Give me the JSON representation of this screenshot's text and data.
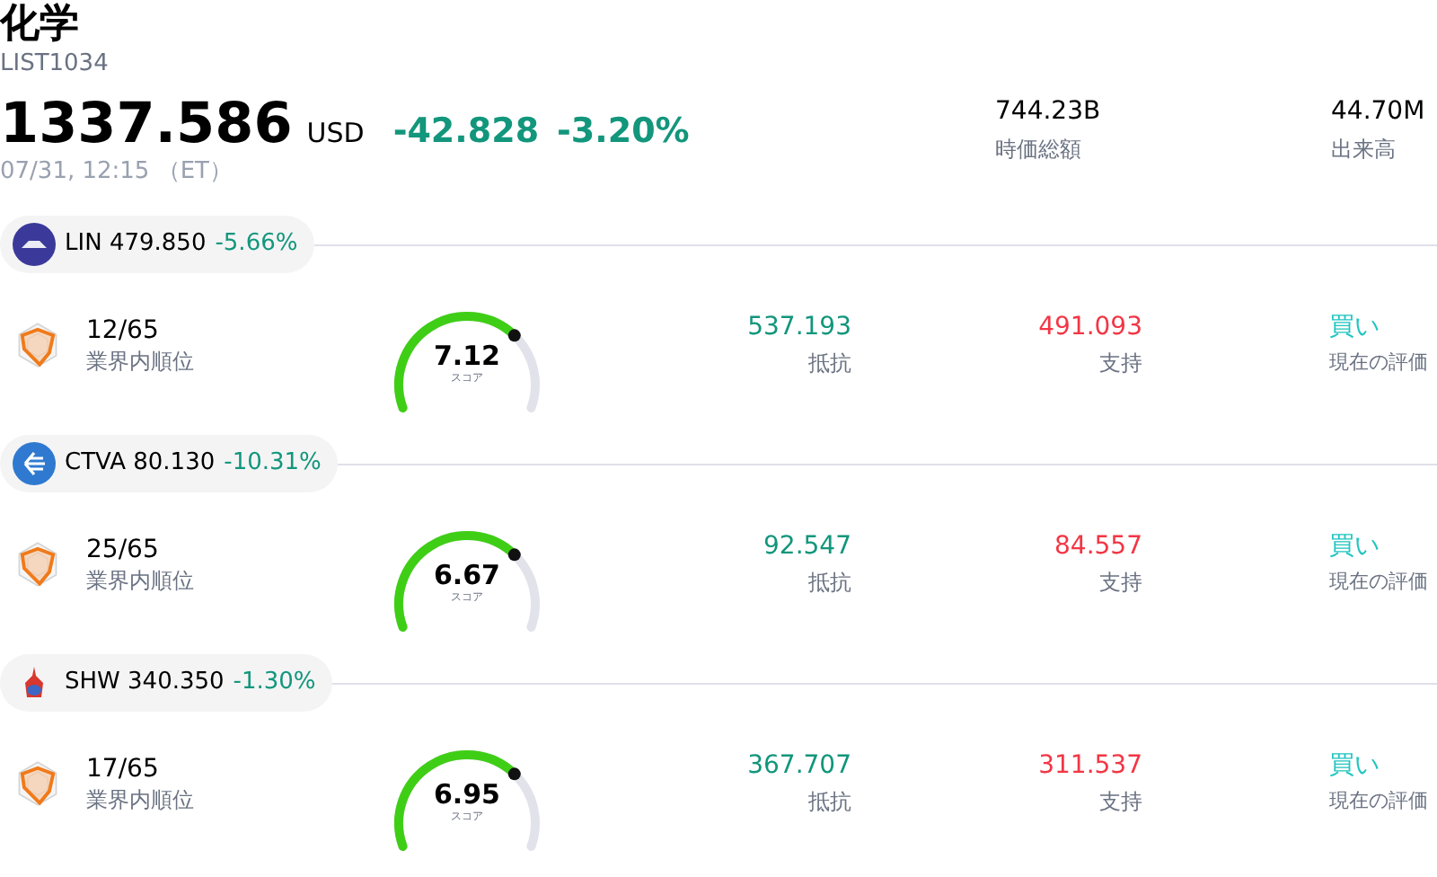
{
  "header": {
    "title": "化学",
    "code": "LIST1034",
    "price": "1337.586",
    "currency": "USD",
    "change": "-42.828",
    "change_percent": "-3.20%",
    "timestamp": "07/31, 12:15 （ET）",
    "stats": [
      {
        "value": "744.23B",
        "label": "時価総額"
      },
      {
        "value": "44.70M",
        "label": "出来高"
      }
    ]
  },
  "stocks": [
    {
      "kind": "bridge",
      "ticker": "LIN",
      "price": "479.850",
      "change": "-5.66%",
      "rank": "12/65",
      "rank_label": "業界内順位",
      "score": "7.12",
      "score_label": "スコア",
      "resistance": "537.193",
      "resistance_label": "抵抗",
      "support": "491.093",
      "support_label": "支持",
      "rating": "買い",
      "rating_label": "現在の評価"
    },
    {
      "kind": "arrows",
      "ticker": "CTVA",
      "price": "80.130",
      "change": "-10.31%",
      "rank": "25/65",
      "rank_label": "業界内順位",
      "score": "6.67",
      "score_label": "スコア",
      "resistance": "92.547",
      "resistance_label": "抵抗",
      "support": "84.557",
      "support_label": "支持",
      "rating": "買い",
      "rating_label": "現在の評価"
    },
    {
      "kind": "paint",
      "ticker": "SHW",
      "price": "340.350",
      "change": "-1.30%",
      "rank": "17/65",
      "rank_label": "業界内順位",
      "score": "6.95",
      "score_label": "スコア",
      "resistance": "367.707",
      "resistance_label": "抵抗",
      "support": "311.537",
      "support_label": "支持",
      "rating": "買い",
      "rating_label": "現在の評価"
    }
  ]
}
